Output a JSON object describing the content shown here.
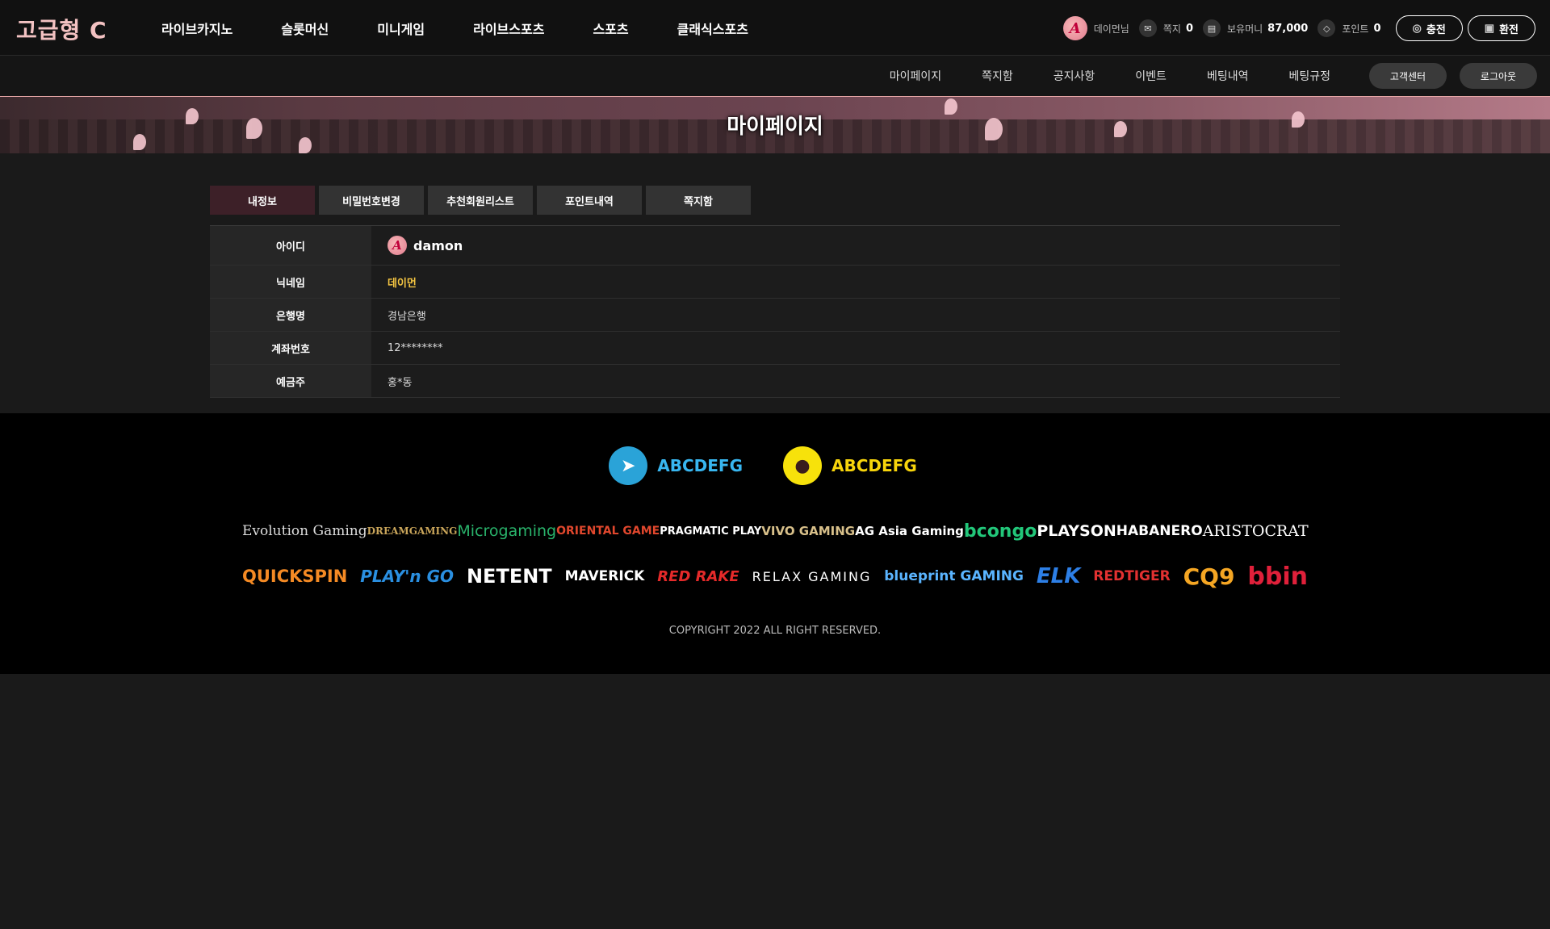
{
  "logo": "고급형 C",
  "main_nav": [
    "라이브카지노",
    "슬롯머신",
    "미니게임",
    "라이브스포츠",
    "스포츠",
    "클래식스포츠"
  ],
  "user": {
    "badge_letter": "A",
    "nickname_greeting": "데이먼님",
    "messages_label": "쪽지",
    "messages_count": "0",
    "money_label": "보유머니",
    "money_value": "87,000",
    "points_label": "포인트",
    "points_value": "0",
    "deposit_label": "충전",
    "withdraw_label": "환전"
  },
  "sub_nav": [
    "마이페이지",
    "쪽지함",
    "공지사항",
    "이벤트",
    "베팅내역",
    "베팅규정"
  ],
  "sub_buttons": {
    "support": "고객센터",
    "logout": "로그아웃"
  },
  "banner_title": "마이페이지",
  "tabs": [
    {
      "label": "내정보",
      "active": true
    },
    {
      "label": "비밀번호변경",
      "active": false
    },
    {
      "label": "추천회원리스트",
      "active": false
    },
    {
      "label": "포인트내역",
      "active": false
    },
    {
      "label": "쪽지함",
      "active": false
    }
  ],
  "info": {
    "id_label": "아이디",
    "id_value": "damon",
    "nick_label": "닉네임",
    "nick_value": "데이먼",
    "bank_label": "은행명",
    "bank_value": "경남은행",
    "account_label": "계좌번호",
    "account_value": "12********",
    "holder_label": "예금주",
    "holder_value": "홍*동"
  },
  "contacts": {
    "telegram": "ABCDEFG",
    "kakao": "ABCDEFG"
  },
  "providers_row1": [
    "Evolution Gaming",
    "DREAMGAMING",
    "Microgaming",
    "ORIENTAL GAME",
    "PRAGMATIC PLAY",
    "VIVO GAMING",
    "AG Asia Gaming",
    "bcongo",
    "PLAYSON",
    "HABANERO",
    "ARISTOCRAT"
  ],
  "providers_row2": [
    "QUICKSPIN",
    "PLAY'n GO",
    "NETENT",
    "MAVERICK",
    "RED RAKE",
    "RELAX GAMING",
    "blueprint GAMING",
    "ELK",
    "REDTIGER",
    "CQ9",
    "bbin"
  ],
  "copyright": "COPYRIGHT 2022  ALL RIGHT RESERVED."
}
